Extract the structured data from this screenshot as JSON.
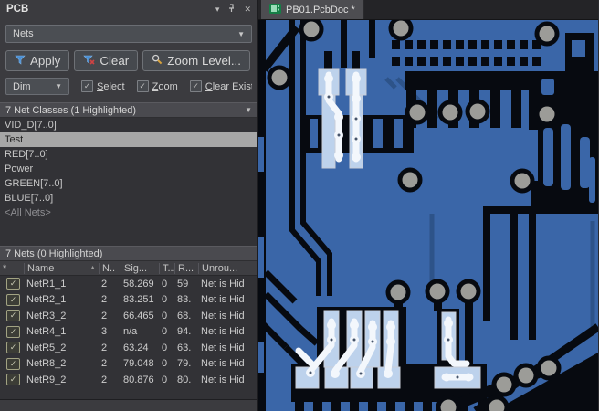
{
  "icons": {
    "panel_collapse": "▾",
    "panel_close": "✕",
    "dropdown_arrow": "▼",
    "sort_ascending": "▲",
    "checkbox_check": "✓"
  },
  "panel": {
    "title": "PCB",
    "selector": {
      "value": "Nets"
    },
    "buttons": {
      "apply": "Apply",
      "clear": "Clear",
      "zoom_level": "Zoom Level..."
    },
    "dim": {
      "value": "Dim",
      "checkboxes": [
        {
          "label": "Select",
          "checked": true
        },
        {
          "label": "Zoom",
          "checked": true
        },
        {
          "label": "Clear Existing",
          "checked": true
        }
      ]
    },
    "net_classes": {
      "header": "7 Net Classes (1 Highlighted)",
      "items": [
        {
          "label": "VID_D[7..0]"
        },
        {
          "label": "Test"
        },
        {
          "label": "RED[7..0]"
        },
        {
          "label": "Power"
        },
        {
          "label": "GREEN[7..0]"
        },
        {
          "label": "BLUE[7..0]"
        },
        {
          "label": "<All Nets>"
        }
      ]
    },
    "nets": {
      "header": "7 Nets (0 Highlighted)",
      "columns": [
        "*",
        "Name",
        "N..",
        "Sig...",
        "T...",
        "R...",
        "Unrou..."
      ],
      "rows": [
        {
          "checked": true,
          "name": "NetR1_1",
          "nodes": "2",
          "signal": "58.269",
          "t": "0",
          "r": "59",
          "unrouted": "Net is Hid"
        },
        {
          "checked": true,
          "name": "NetR2_1",
          "nodes": "2",
          "signal": "83.251",
          "t": "0",
          "r": "83.",
          "unrouted": "Net is Hid"
        },
        {
          "checked": true,
          "name": "NetR3_2",
          "nodes": "2",
          "signal": "66.465",
          "t": "0",
          "r": "68.",
          "unrouted": "Net is Hid"
        },
        {
          "checked": true,
          "name": "NetR4_1",
          "nodes": "3",
          "signal": "n/a",
          "t": "0",
          "r": "94.",
          "unrouted": "Net is Hid"
        },
        {
          "checked": true,
          "name": "NetR5_2",
          "nodes": "2",
          "signal": "63.24",
          "t": "0",
          "r": "63.",
          "unrouted": "Net is Hid"
        },
        {
          "checked": true,
          "name": "NetR8_2",
          "nodes": "2",
          "signal": "79.048",
          "t": "0",
          "r": "79.",
          "unrouted": "Net is Hid"
        },
        {
          "checked": true,
          "name": "NetR9_2",
          "nodes": "2",
          "signal": "80.876",
          "t": "0",
          "r": "80.",
          "unrouted": "Net is Hid"
        }
      ]
    }
  },
  "editor": {
    "tab": {
      "label": "PB01.PcbDoc *"
    },
    "colors": {
      "board_blue": "#3a66a8",
      "dim_trace": "#2d5389",
      "pcb_black": "#070a10",
      "pad_blue": "#bdd2ec",
      "hl_white": "#f3f7fc",
      "via_gray": "#9c9c98"
    }
  }
}
